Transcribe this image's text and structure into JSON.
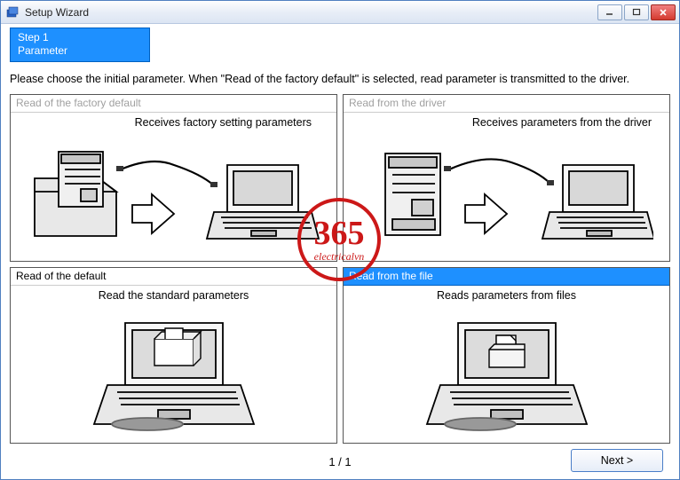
{
  "window": {
    "title": "Setup Wizard"
  },
  "step": {
    "line1": "Step 1",
    "line2": "Parameter"
  },
  "instruction": "Please choose the initial parameter. When \"Read of the factory default\" is selected, read parameter is transmitted to the driver.",
  "options": [
    {
      "id": "factory-default",
      "header": "Read of the factory default",
      "caption": "Receives factory setting parameters",
      "state": "disabled"
    },
    {
      "id": "from-driver",
      "header": "Read from the driver",
      "caption": "Receives parameters from the driver",
      "state": "disabled"
    },
    {
      "id": "of-default",
      "header": "Read of the default",
      "caption": "Read the standard parameters",
      "state": "enabled"
    },
    {
      "id": "from-file",
      "header": "Read from the file",
      "caption": "Reads parameters from files",
      "state": "selected"
    }
  ],
  "footer": {
    "page": "1 / 1",
    "next_label": "Next >"
  },
  "watermark": {
    "num": "365",
    "sub": "electricalvn"
  }
}
